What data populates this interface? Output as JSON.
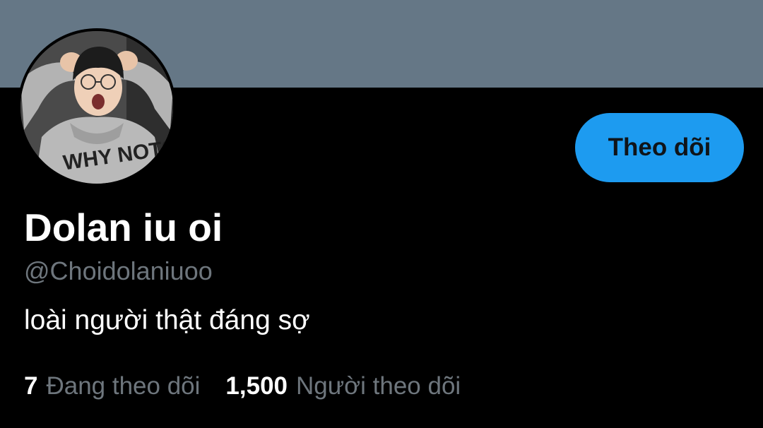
{
  "profile": {
    "display_name": "Dolan iu oi",
    "handle": "@Choidolaniuoo",
    "bio": "loài người thật đáng sợ",
    "follow_button_label": "Theo dõi",
    "following_count": "7",
    "following_label": "Đang theo dõi",
    "followers_count": "1,500",
    "followers_label": "Người theo dõi",
    "avatar_shirt_text": "WHY NOT?!"
  },
  "colors": {
    "banner": "#657786",
    "background": "#000000",
    "accent": "#1d9bf0",
    "primary_text": "#ffffff",
    "secondary_text": "#6e767d"
  }
}
